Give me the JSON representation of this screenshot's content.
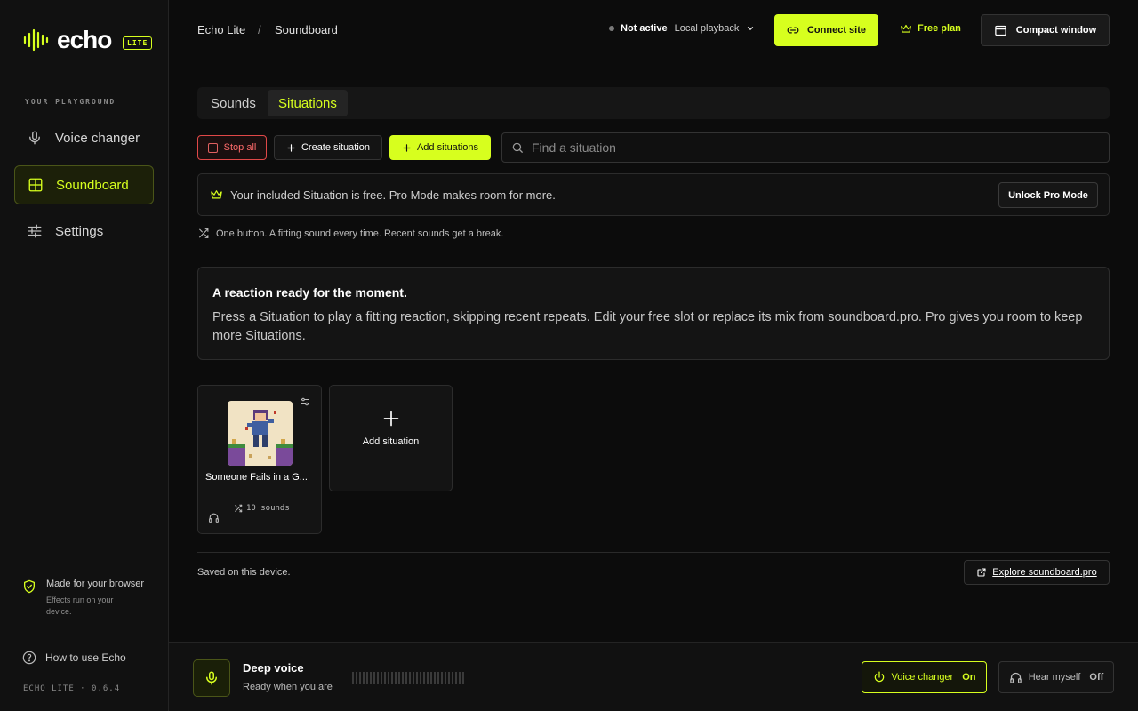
{
  "app": {
    "logo_text": "echo",
    "badge": "LITE",
    "version": "ECHO LITE · 0.6.4"
  },
  "sidebar": {
    "section_label": "YOUR PLAYGROUND",
    "items": [
      {
        "label": "Voice changer",
        "icon": "mic-icon"
      },
      {
        "label": "Soundboard",
        "icon": "grid-icon",
        "active": true
      },
      {
        "label": "Settings",
        "icon": "sliders-icon"
      }
    ],
    "browser_note": {
      "title": "Made for your browser",
      "subtitle": "Effects run on your device."
    },
    "how_to": "How to use Echo"
  },
  "header": {
    "breadcrumb": [
      "Echo Lite",
      "/",
      "Soundboard"
    ],
    "status_strong": "Not active",
    "status_mode": "Local playback",
    "connect_label": "Connect site",
    "plan_label": "Free plan",
    "compact_label": "Compact window"
  },
  "tabs": [
    {
      "label": "Sounds",
      "active": false
    },
    {
      "label": "Situations",
      "active": true
    }
  ],
  "toolbar": {
    "stop_all": "Stop all",
    "create_situation": "Create situation",
    "add_situations": "Add situations",
    "search_placeholder": "Find a situation"
  },
  "pro_banner": {
    "text": "Your included Situation is free. Pro Mode makes room for more.",
    "button": "Unlock Pro Mode"
  },
  "hint": "One button. A fitting sound every time. Recent sounds get a break.",
  "info_card": {
    "heading": "A reaction ready for the moment.",
    "body": "Press a Situation to play a fitting reaction, skipping recent repeats. Edit your free slot or replace its mix from soundboard.pro. Pro gives you room to keep more Situations."
  },
  "situations": [
    {
      "name": "Someone Fails in a G...",
      "sound_count": "10 sounds"
    }
  ],
  "add_card_label": "Add situation",
  "footer": {
    "saved": "Saved on this device.",
    "explore": "Explore soundboard.pro"
  },
  "bottom_bar": {
    "voice_name": "Deep voice",
    "voice_status": "Ready when you are",
    "voice_changer_label": "Voice changer",
    "voice_changer_state": "On",
    "hear_myself_label": "Hear myself",
    "hear_myself_state": "Off"
  },
  "colors": {
    "accent": "#d7ff1e",
    "danger": "#e04848",
    "background": "#0c0c0c"
  }
}
